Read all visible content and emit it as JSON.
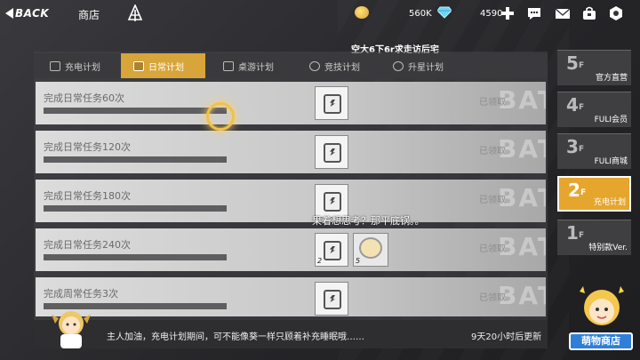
{
  "topbar": {
    "back_label": "BACK",
    "title": "商店",
    "currency1_value": "560K",
    "currency2_value": "4590",
    "icons": [
      "tree-icon",
      "coin-icon",
      "diamond-icon",
      "plus-icon",
      "chat-icon",
      "mail-icon",
      "bag-icon",
      "settings-icon"
    ]
  },
  "banner": "空大6下6r求走访后宅",
  "tabs": [
    {
      "label": "充电计划",
      "active": false
    },
    {
      "label": "日常计划",
      "active": true
    },
    {
      "label": "桌游计划",
      "active": false
    },
    {
      "label": "竞技计划",
      "active": false
    },
    {
      "label": "升星计划",
      "active": false
    }
  ],
  "tasks": [
    {
      "label": "完成日常任务60次",
      "status": "已领取",
      "reward_qty": ""
    },
    {
      "label": "完成日常任务120次",
      "status": "已领取",
      "reward_qty": ""
    },
    {
      "label": "完成日常任务180次",
      "status": "已领取",
      "reward_qty": ""
    },
    {
      "label": "完成日常任务240次",
      "status": "已领取",
      "reward_qty": "2",
      "extra_reward_qty": "5"
    },
    {
      "label": "完成周常任务3次",
      "status": "已领取",
      "reward_qty": ""
    }
  ],
  "watermark": "BAT",
  "overlay_speech": "果着想思考？那平底锅。。",
  "bottom": {
    "message": "主人加油，充电计划期间，可不能像葵一样只顾着补充睡眠哦……",
    "reset": "9天20小时后更新"
  },
  "floors": [
    {
      "num": "5",
      "label": "官方直营",
      "active": false
    },
    {
      "num": "4",
      "label": "FULI会员",
      "active": false
    },
    {
      "num": "3",
      "label": "FULI商城",
      "active": false
    },
    {
      "num": "2",
      "label": "充电计划",
      "active": true
    },
    {
      "num": "1",
      "label": "特别款Ver.",
      "active": false
    }
  ],
  "floor_suffix": "F",
  "shop_button_label": "萌物商店",
  "colors": {
    "accent": "#d8a53a",
    "active_floor": "#e6a62e",
    "shop_blue": "#2f7fd8"
  }
}
